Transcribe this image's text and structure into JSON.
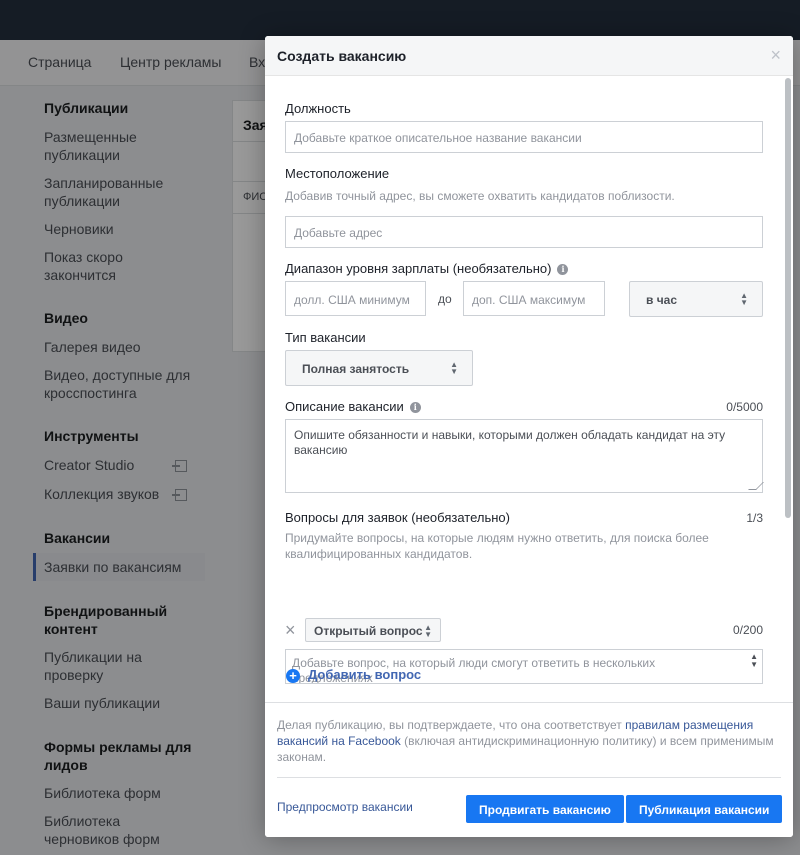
{
  "nav": {
    "items": [
      "Страница",
      "Центр рекламы",
      "Вх"
    ]
  },
  "sidebar": {
    "publications": {
      "heading": "Публикации",
      "items": [
        "Размещенные публикации",
        "Запланированные публикации",
        "Черновики",
        "Показ скоро закончится"
      ]
    },
    "video": {
      "heading": "Видео",
      "items": [
        "Галерея видео",
        "Видео, доступные для кросспостинга"
      ]
    },
    "tools": {
      "heading": "Инструменты",
      "items": [
        "Creator Studio",
        "Коллекция звуков"
      ]
    },
    "jobs": {
      "heading": "Вакансии",
      "items": [
        "Заявки по вакансиям"
      ]
    },
    "branded": {
      "heading": "Брендированный контент",
      "items": [
        "Публикации на проверку",
        "Ваши публикации"
      ]
    },
    "leadforms": {
      "heading": "Формы рекламы для лидов",
      "items": [
        "Библиотека форм",
        "Библиотека черновиков форм"
      ]
    }
  },
  "bg_panel": {
    "title": "Зая",
    "col": "ФИС"
  },
  "modal": {
    "title": "Создать вакансию",
    "close": "×",
    "position": {
      "label": "Должность",
      "placeholder": "Добавьте краткое описательное название вакансии"
    },
    "location": {
      "label": "Местоположение",
      "hint": "Добавив точный адрес, вы сможете охватить кандидатов поблизости.",
      "placeholder": "Добавьте адрес"
    },
    "salary": {
      "label": "Диапазон уровня зарплаты (необязательно)",
      "min_placeholder": "долл. США минимум",
      "to": "до",
      "max_placeholder": "доп. США максимум",
      "period": "в час"
    },
    "job_type": {
      "label": "Тип вакансии",
      "value": "Полная занятость"
    },
    "description": {
      "label": "Описание вакансии",
      "counter": "0/5000",
      "placeholder": "Опишите обязанности и навыки, которыми должен обладать кандидат на эту вакансию"
    },
    "questions": {
      "label": "Вопросы для заявок (необязательно)",
      "counter": "1/3",
      "hint": "Придумайте вопросы, на которые людям нужно ответить, для поиска более квалифицированных кандидатов.",
      "remove": "×",
      "type": "Открытый вопрос",
      "char_counter": "0/200",
      "placeholder": "Добавьте вопрос, на который люди смогут ответить в нескольких предложениях"
    },
    "add_question": "Добавить вопрос",
    "terms": {
      "before": "Делая публикацию, вы подтверждаете, что она соответствует ",
      "link": "правилам размещения вакансий на Facebook",
      "after": " (включая антидискриминационную политику) и всем применимым законам."
    },
    "preview": "Предпросмотр вакансии",
    "promote_button": "Продвигать вакансию",
    "publish_button": "Публикация вакансии"
  }
}
